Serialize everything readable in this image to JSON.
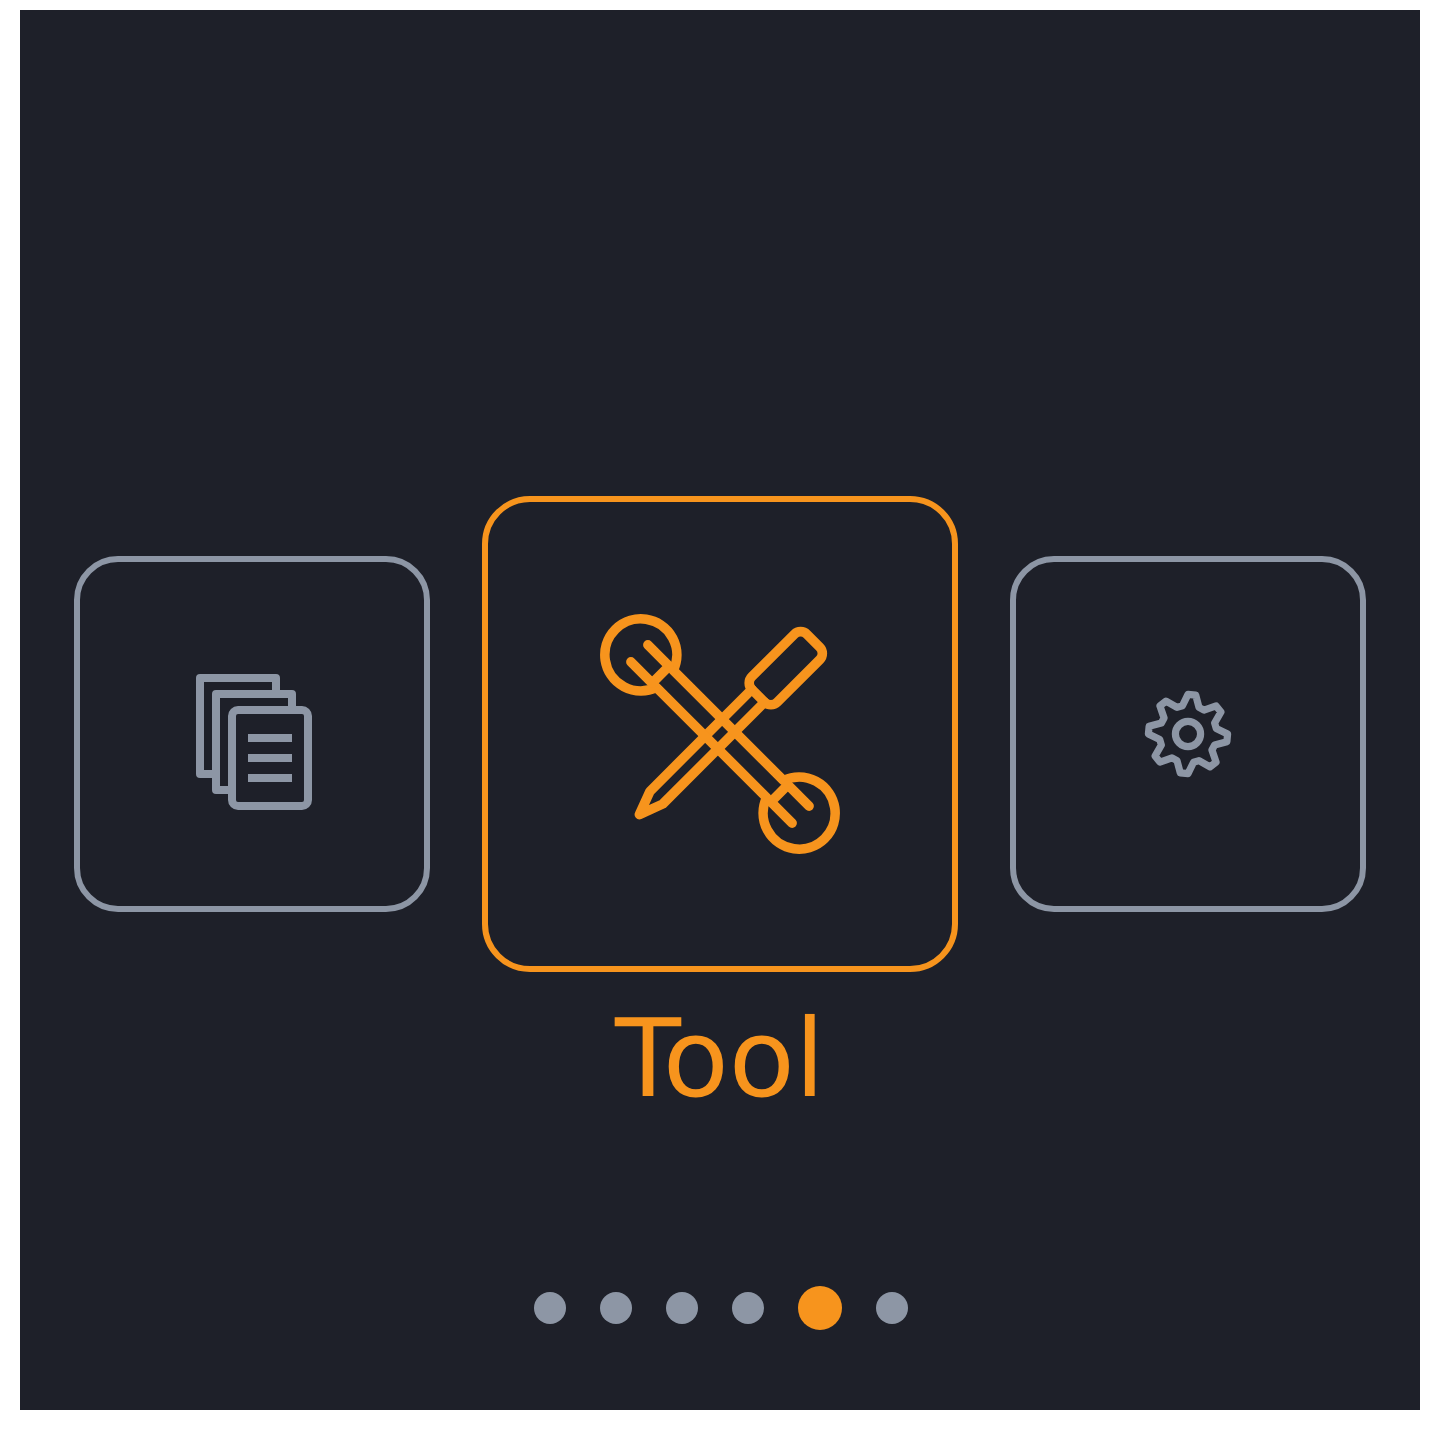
{
  "menu_items": [
    {
      "kind": "documents",
      "selected": false
    },
    {
      "kind": "tool",
      "selected": true
    },
    {
      "kind": "settings",
      "selected": false
    }
  ],
  "label": "Tool",
  "pager": [
    {
      "selected": false
    },
    {
      "selected": false
    },
    {
      "selected": false
    },
    {
      "selected": false
    },
    {
      "selected": true
    },
    {
      "selected": false
    }
  ]
}
